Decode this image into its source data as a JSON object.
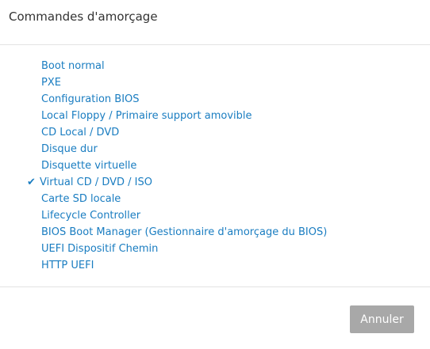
{
  "dialog": {
    "title": "Commandes d'amorçage"
  },
  "menu": {
    "check_glyph": "✔",
    "items": [
      {
        "label": "Boot normal",
        "selected": false
      },
      {
        "label": "PXE",
        "selected": false
      },
      {
        "label": "Configuration BIOS",
        "selected": false
      },
      {
        "label": "Local Floppy / Primaire support amovible",
        "selected": false
      },
      {
        "label": "CD Local / DVD",
        "selected": false
      },
      {
        "label": "Disque dur",
        "selected": false
      },
      {
        "label": "Disquette virtuelle",
        "selected": false
      },
      {
        "label": "Virtual CD / DVD / ISO",
        "selected": true
      },
      {
        "label": "Carte SD locale",
        "selected": false
      },
      {
        "label": "Lifecycle Controller",
        "selected": false
      },
      {
        "label": "BIOS Boot Manager (Gestionnaire d'amorçage du BIOS)",
        "selected": false
      },
      {
        "label": "UEFI Dispositif Chemin",
        "selected": false
      },
      {
        "label": "HTTP UEFI",
        "selected": false
      }
    ]
  },
  "footer": {
    "cancel_label": "Annuler"
  },
  "colors": {
    "link": "#1a7dc1",
    "title": "#333333",
    "button_bg": "#a8a8a8",
    "divider": "#e3e3e3"
  }
}
